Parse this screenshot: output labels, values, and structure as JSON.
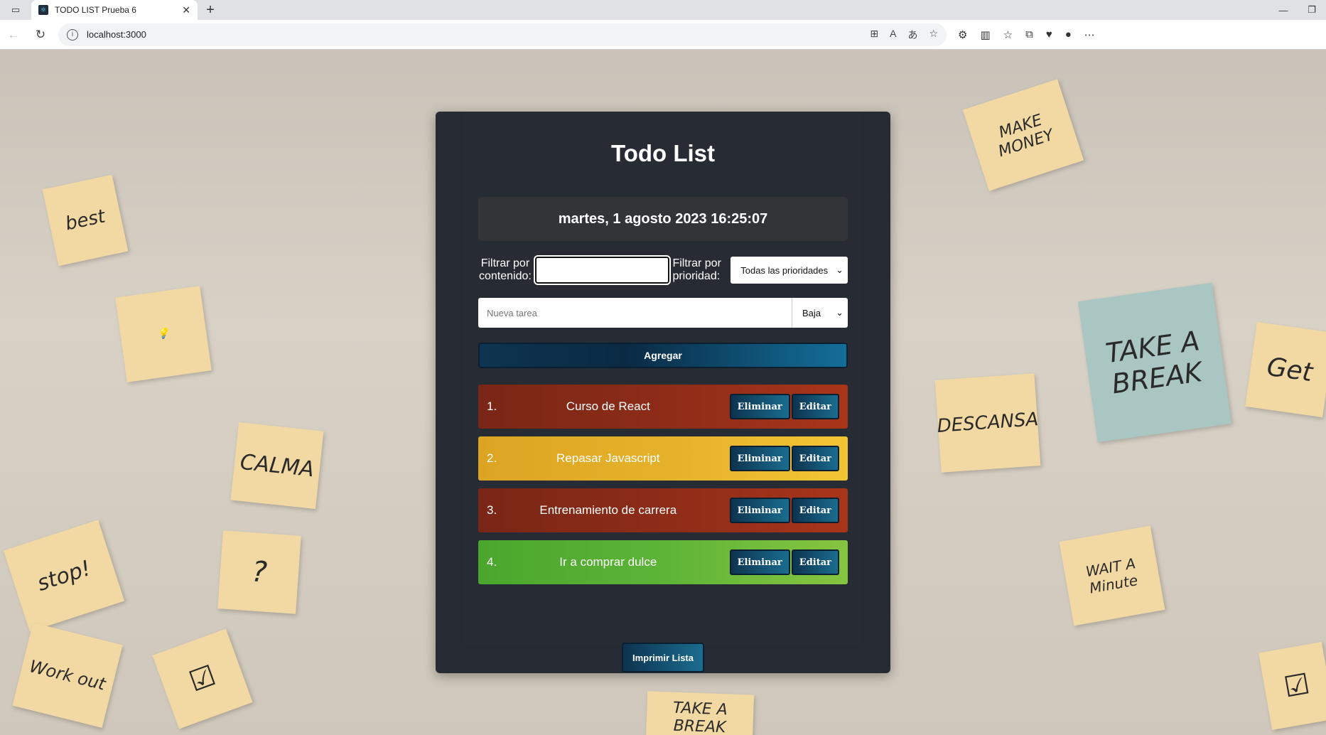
{
  "browser": {
    "tab_title": "TODO LIST Prueba 6",
    "new_tab_symbol": "+",
    "url": "localhost:3000"
  },
  "app": {
    "title": "Todo List",
    "datetime": "martes, 1 agosto 2023 16:25:07",
    "filter_content_label": "Filtrar por contenido:",
    "filter_content_value": "",
    "filter_priority_label": "Filtrar por prioridad:",
    "filter_priority_selected": "Todas las prioridades",
    "new_task_placeholder": "Nueva tarea",
    "new_task_priority_selected": "Baja",
    "add_label": "Agregar",
    "print_label": "Imprimir Lista",
    "tasks": [
      {
        "num": "1.",
        "text": "Curso de React",
        "delete_label": "Eliminar",
        "edit_label": "Editar",
        "color": "#8b2a1a"
      },
      {
        "num": "2.",
        "text": "Repasar Javascript",
        "delete_label": "Eliminar",
        "edit_label": "Editar",
        "color": "#e0a925"
      },
      {
        "num": "3.",
        "text": "Entrenamiento de carrera",
        "delete_label": "Eliminar",
        "edit_label": "Editar",
        "color": "#8b2a1a"
      },
      {
        "num": "4.",
        "text": "Ir a comprar dulce",
        "delete_label": "Eliminar",
        "edit_label": "Editar",
        "color": "#59b034"
      }
    ]
  },
  "colors": {
    "card_bg": "#262b33",
    "button_gradient_start": "#0d3450",
    "button_gradient_end": "#1a6c8f",
    "high_priority": "#8b2a1a",
    "medium_priority": "#e0a925",
    "low_priority": "#59b034"
  },
  "background_notes": [
    "best",
    "CALMA",
    "stop!",
    "?",
    "Work out",
    "MAKE MONEY",
    "TAKE A BREAK",
    "DESCANSA",
    "WAIT A Minute",
    "Get",
    "TAKE A BREAK"
  ]
}
